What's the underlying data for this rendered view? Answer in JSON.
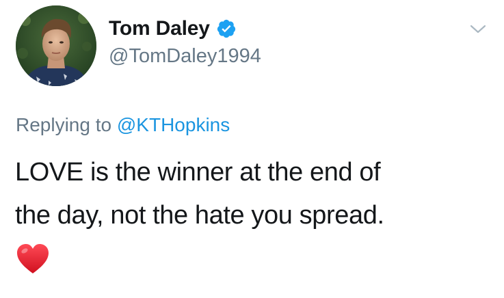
{
  "user": {
    "display_name": "Tom Daley",
    "handle": "@TomDaley1994",
    "verified": true
  },
  "reply": {
    "prefix": "Replying to",
    "mention": "@KTHopkins"
  },
  "tweet": {
    "lines": [
      "LOVE is the winner at the end of",
      "the day, not the hate you spread."
    ],
    "emoji": "red-heart"
  },
  "icons": {
    "verified": "verified-badge-icon",
    "menu": "chevron-down-icon",
    "emoji": "red-heart-icon"
  },
  "colors": {
    "name": "#14171a",
    "secondary": "#657786",
    "link": "#1b95e0",
    "verified": "#1da1f2",
    "heart": "#e0182d"
  }
}
